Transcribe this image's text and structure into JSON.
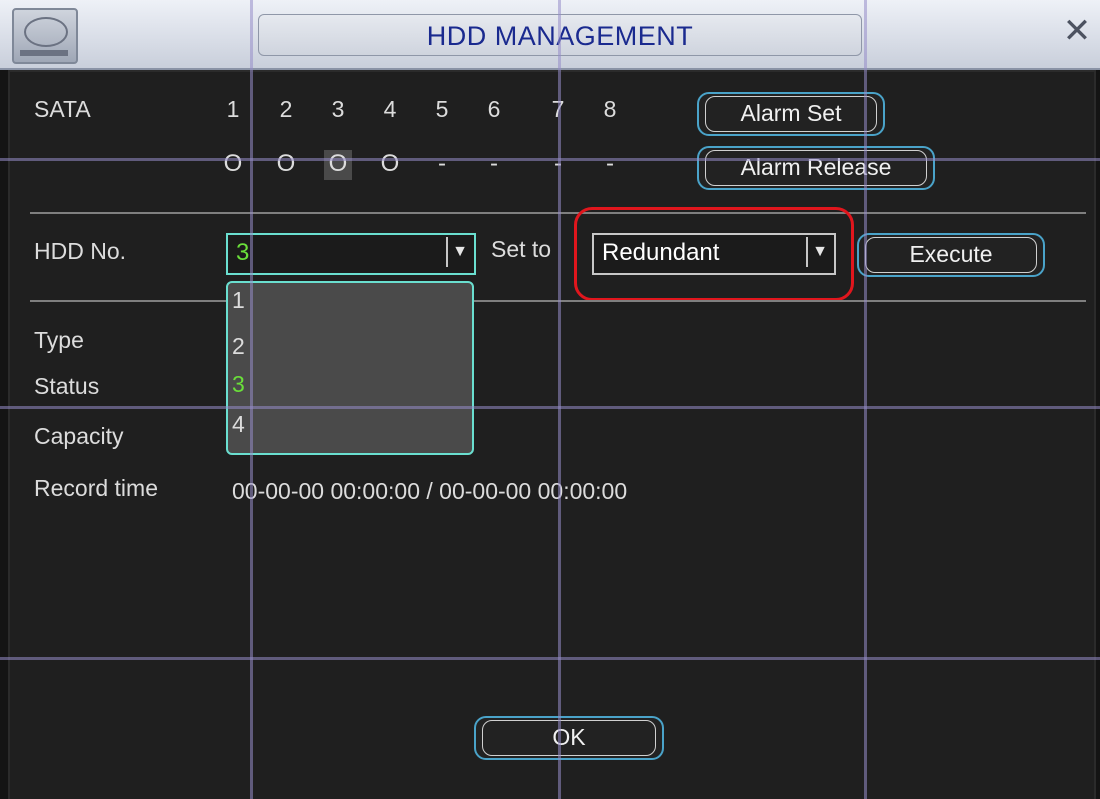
{
  "window": {
    "title": "HDD MANAGEMENT",
    "close_symbol": "✕",
    "icon": "hard-drive-icon"
  },
  "sata": {
    "label": "SATA",
    "ports": [
      "1",
      "2",
      "3",
      "4",
      "5",
      "6",
      "7",
      "8"
    ],
    "states": [
      "O",
      "O",
      "O",
      "O",
      "-",
      "-",
      "-",
      "-"
    ]
  },
  "buttons": {
    "alarm_set": "Alarm Set",
    "alarm_release": "Alarm Release",
    "execute": "Execute",
    "ok": "OK"
  },
  "hdd": {
    "label": "HDD No.",
    "selected": "3",
    "options": [
      "1",
      "2",
      "3",
      "4"
    ]
  },
  "set_to": {
    "label": "Set to",
    "value": "Redundant"
  },
  "info": {
    "type_label": "Type",
    "status_label": "Status",
    "capacity_label": "Capacity",
    "record_time_label": "Record time",
    "record_time_value": "00-00-00 00:00:00 / 00-00-00 00:00:00"
  },
  "colors": {
    "accent_cyan": "#6adfd0",
    "highlight_green": "#6adf3a",
    "red_annotation": "#e0161d",
    "title_blue": "#1a2a8f"
  }
}
